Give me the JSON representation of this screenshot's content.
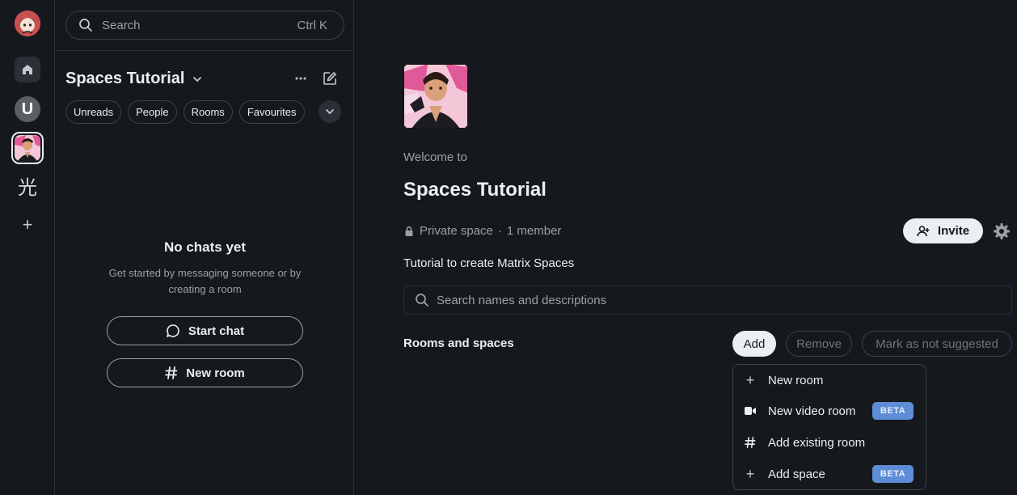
{
  "search": {
    "label": "Search",
    "shortcut": "Ctrl K"
  },
  "roomlist": {
    "title": "Spaces Tutorial",
    "filters": [
      "Unreads",
      "People",
      "Rooms",
      "Favourites"
    ],
    "empty_title": "No chats yet",
    "empty_body": "Get started by messaging someone or by creating a room",
    "start_chat": "Start chat",
    "new_room": "New room"
  },
  "spacebar": {
    "u_initial": "U",
    "kanji": "光"
  },
  "space": {
    "welcome": "Welcome to",
    "name": "Spaces Tutorial",
    "privacy": "Private space",
    "separator": "·",
    "members": "1 member",
    "invite": "Invite",
    "topic": "Tutorial to create Matrix Spaces",
    "search_placeholder": "Search names and descriptions",
    "rooms_label": "Rooms and spaces",
    "add": "Add",
    "remove": "Remove",
    "mark_not_suggested": "Mark as not suggested"
  },
  "add_menu": {
    "items": [
      {
        "label": "New room",
        "icon": "plus-icon"
      },
      {
        "label": "New video room",
        "icon": "video-icon",
        "badge": "BETA"
      },
      {
        "label": "Add existing room",
        "icon": "hash-icon"
      },
      {
        "label": "Add space",
        "icon": "plus-icon",
        "badge": "BETA"
      }
    ]
  },
  "colors": {
    "background": "#15191e",
    "accent_badge": "#5e8cd6",
    "text": "#ebeef2",
    "muted": "#9ba0a7"
  }
}
